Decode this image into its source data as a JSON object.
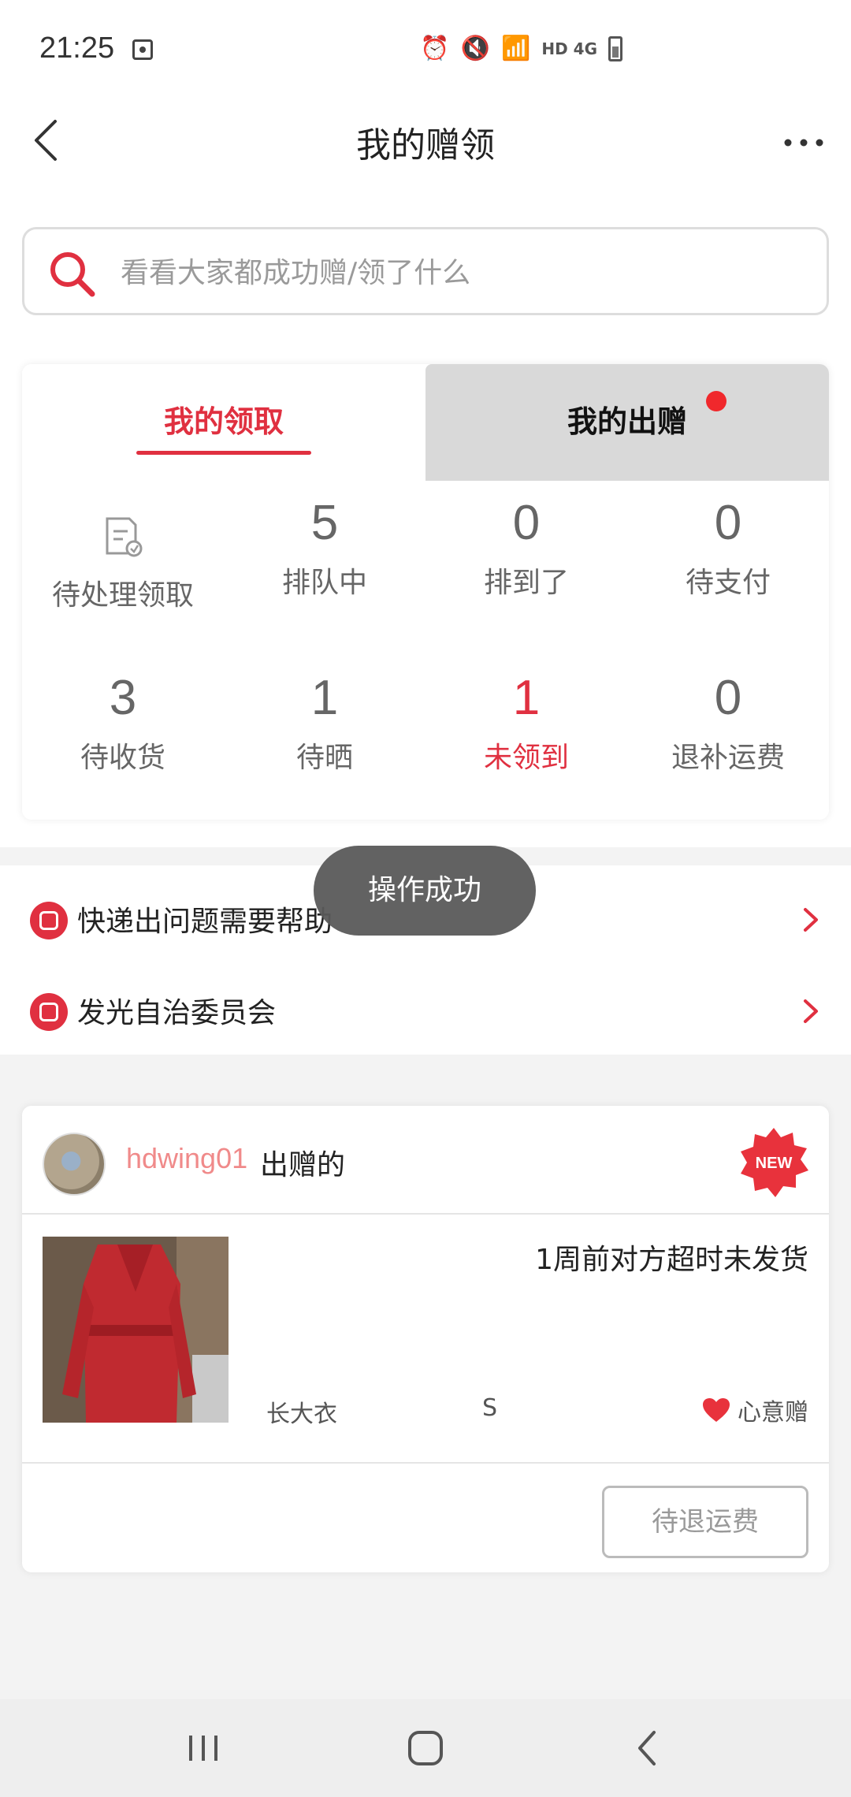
{
  "status_bar": {
    "time": "21:25",
    "network": "HD 4G"
  },
  "header": {
    "title": "我的赠领"
  },
  "search": {
    "placeholder": "看看大家都成功赠/领了什么"
  },
  "tabs": [
    {
      "label": "我的领取",
      "active": true
    },
    {
      "label": "我的出赠",
      "active": false,
      "has_dot": true
    }
  ],
  "stats": [
    {
      "value": "",
      "icon": "document-icon",
      "label": "待处理领取"
    },
    {
      "value": "5",
      "label": "排队中"
    },
    {
      "value": "0",
      "label": "排到了"
    },
    {
      "value": "0",
      "label": "待支付"
    },
    {
      "value": "3",
      "label": "待收货"
    },
    {
      "value": "1",
      "label": "待晒"
    },
    {
      "value": "1",
      "label": "未领到",
      "highlight": true
    },
    {
      "value": "0",
      "label": "退补运费"
    }
  ],
  "toast": {
    "text": "操作成功"
  },
  "help_links": [
    {
      "label": "快递出问题需要帮助"
    },
    {
      "label": "发光自治委员会"
    }
  ],
  "item": {
    "username": "hdwing01",
    "action": "出赠的",
    "badge": "NEW",
    "status": "1周前对方超时未发货",
    "product_name": "长大衣",
    "size": "S",
    "gift_type": "心意赠",
    "button": "待退运费"
  },
  "colors": {
    "accent": "#e03040",
    "tab_inactive_bg": "#d9d9d9",
    "toast_bg": "#5a5a5a"
  }
}
